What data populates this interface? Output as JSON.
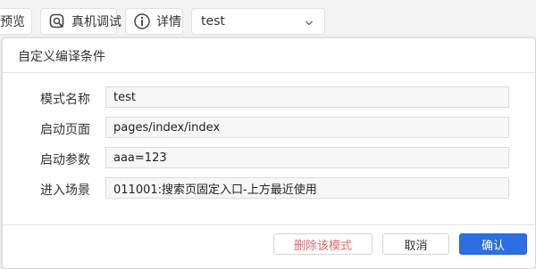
{
  "toolbar": {
    "preview_label": "预览",
    "debug_label": "真机调试",
    "detail_label": "详情",
    "mode_select_value": "test"
  },
  "dialog": {
    "title": "自定义编译条件",
    "fields": [
      {
        "label": "模式名称",
        "value": "test"
      },
      {
        "label": "启动页面",
        "value": "pages/index/index"
      },
      {
        "label": "启动参数",
        "value": "aaa=123"
      },
      {
        "label": "进入场景",
        "value": "011001:搜索页固定入口-上方最近使用"
      }
    ],
    "buttons": {
      "delete": "删除该模式",
      "cancel": "取消",
      "confirm": "确认"
    }
  },
  "colors": {
    "primary": "#2b6fe0",
    "danger_text": "#e06b6b"
  }
}
